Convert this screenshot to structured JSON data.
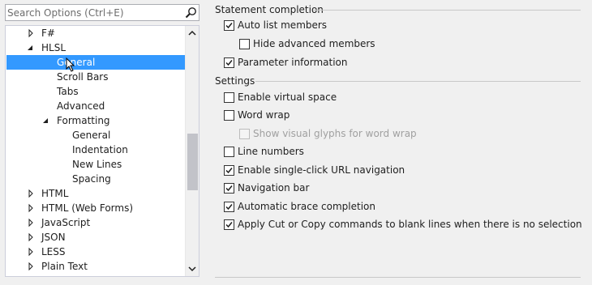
{
  "search": {
    "placeholder": "Search Options (Ctrl+E)"
  },
  "tree": {
    "items": [
      {
        "label": "F#",
        "arrow": "collapsed"
      },
      {
        "label": "HLSL",
        "arrow": "expanded"
      },
      {
        "label": "General",
        "arrow": "none",
        "selected": true
      },
      {
        "label": "Scroll Bars",
        "arrow": "none"
      },
      {
        "label": "Tabs",
        "arrow": "none"
      },
      {
        "label": "Advanced",
        "arrow": "none"
      },
      {
        "label": "Formatting",
        "arrow": "expanded"
      },
      {
        "label": "General",
        "arrow": "none"
      },
      {
        "label": "Indentation",
        "arrow": "none"
      },
      {
        "label": "New Lines",
        "arrow": "none"
      },
      {
        "label": "Spacing",
        "arrow": "none"
      },
      {
        "label": "HTML",
        "arrow": "collapsed"
      },
      {
        "label": "HTML (Web Forms)",
        "arrow": "collapsed"
      },
      {
        "label": "JavaScript",
        "arrow": "collapsed"
      },
      {
        "label": "JSON",
        "arrow": "collapsed"
      },
      {
        "label": "LESS",
        "arrow": "collapsed"
      },
      {
        "label": "Plain Text",
        "arrow": "collapsed"
      }
    ]
  },
  "statement_completion": {
    "title": "Statement completion",
    "options": [
      {
        "label": "Auto list members",
        "checked": true
      },
      {
        "label": "Hide advanced members",
        "checked": false
      },
      {
        "label": "Parameter information",
        "checked": true
      }
    ]
  },
  "settings": {
    "title": "Settings",
    "options": [
      {
        "label": "Enable virtual space",
        "checked": false
      },
      {
        "label": "Word wrap",
        "checked": false
      },
      {
        "label": "Show visual glyphs for word wrap",
        "checked": false,
        "disabled": true
      },
      {
        "label": "Line numbers",
        "checked": false
      },
      {
        "label": "Enable single-click URL navigation",
        "checked": true
      },
      {
        "label": "Navigation bar",
        "checked": true
      },
      {
        "label": "Automatic brace completion",
        "checked": true
      },
      {
        "label": "Apply Cut or Copy commands to blank lines when there is no selection",
        "checked": true
      }
    ]
  },
  "colors": {
    "selection": "#3399ff",
    "background": "#f0f0f0"
  }
}
